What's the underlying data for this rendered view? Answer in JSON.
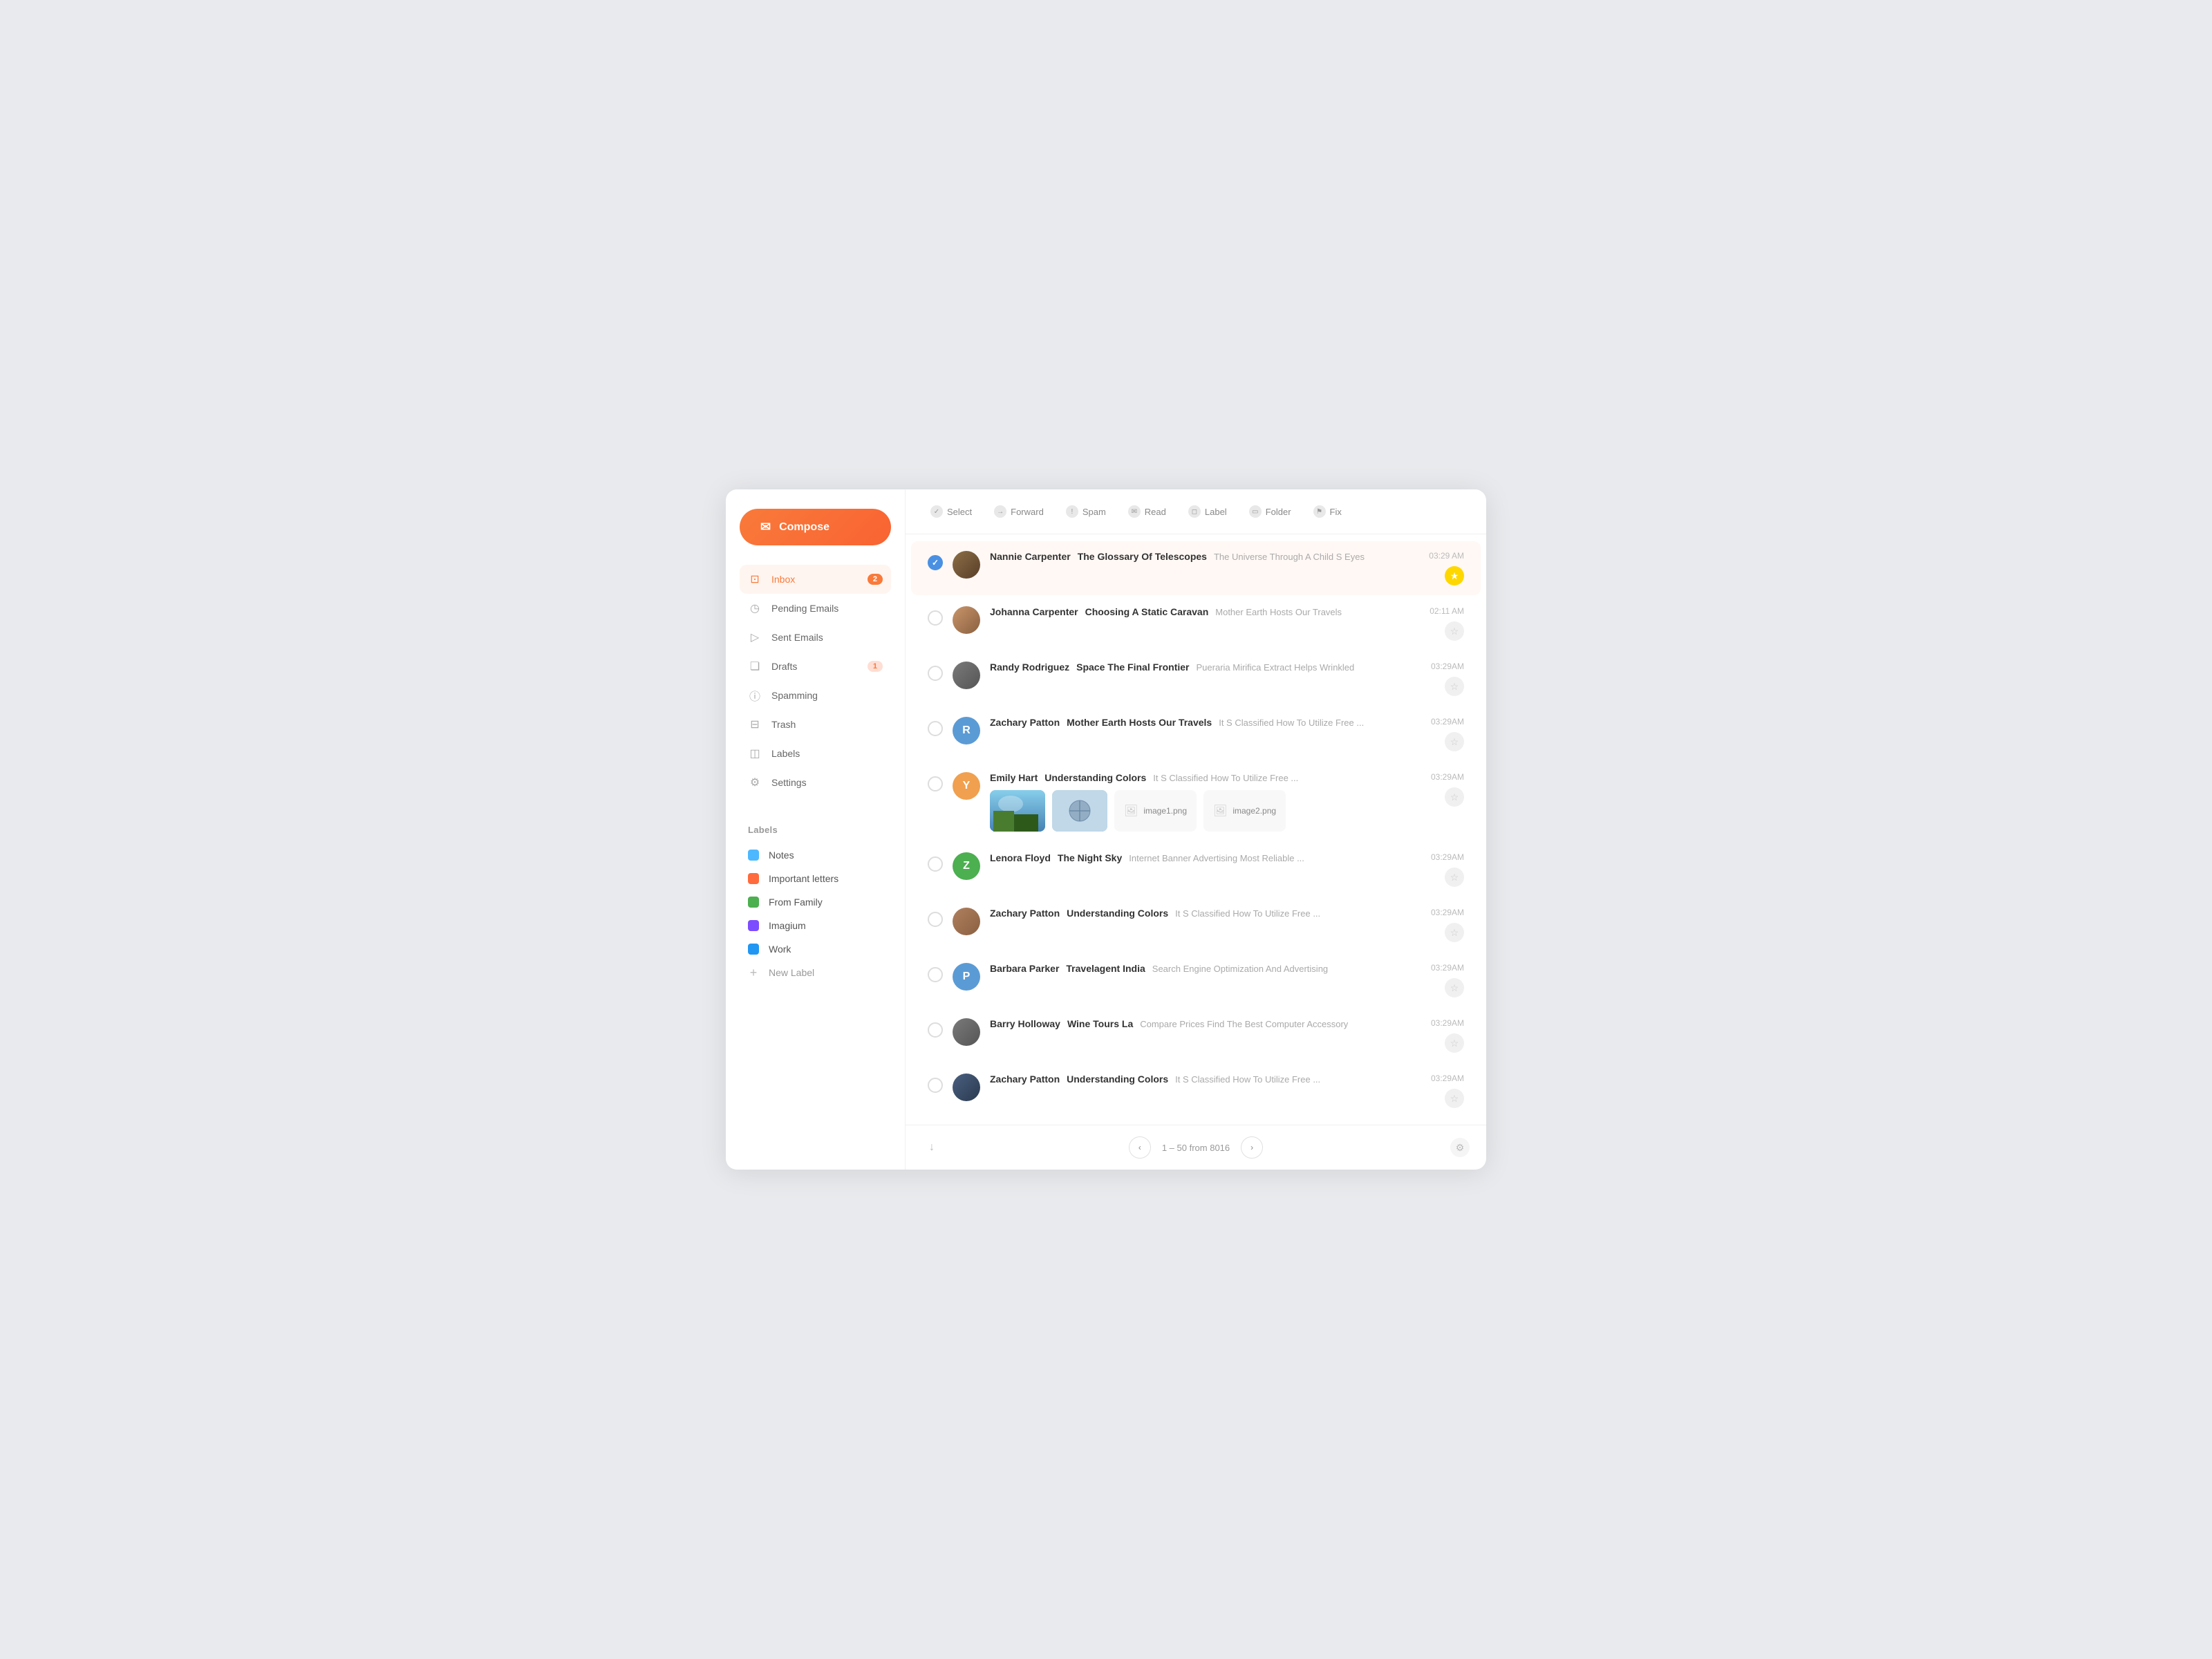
{
  "sidebar": {
    "compose_label": "Compose",
    "nav_items": [
      {
        "id": "inbox",
        "label": "Inbox",
        "badge": "2",
        "badge_type": "default",
        "active": true
      },
      {
        "id": "pending",
        "label": "Pending Emails",
        "badge": null
      },
      {
        "id": "sent",
        "label": "Sent Emails",
        "badge": null
      },
      {
        "id": "drafts",
        "label": "Drafts",
        "badge": "1",
        "badge_type": "draft"
      },
      {
        "id": "spamming",
        "label": "Spamming",
        "badge": null
      },
      {
        "id": "trash",
        "label": "Trash",
        "badge": null
      },
      {
        "id": "labels",
        "label": "Labels",
        "badge": null
      },
      {
        "id": "settings",
        "label": "Settings",
        "badge": null
      }
    ],
    "labels_title": "Labels",
    "labels": [
      {
        "id": "notes",
        "label": "Notes",
        "color": "#4db8ff"
      },
      {
        "id": "important",
        "label": "Important letters",
        "color": "#ff6b3d"
      },
      {
        "id": "family",
        "label": "From Family",
        "color": "#4caf50"
      },
      {
        "id": "imagium",
        "label": "Imagium",
        "color": "#7c4dff"
      },
      {
        "id": "work",
        "label": "Work",
        "color": "#2196f3"
      }
    ],
    "new_label": "New Label"
  },
  "toolbar": {
    "items": [
      {
        "id": "select",
        "label": "Select",
        "icon": "✓"
      },
      {
        "id": "forward",
        "label": "Forward",
        "icon": "→"
      },
      {
        "id": "spam",
        "label": "Spam",
        "icon": "!"
      },
      {
        "id": "read",
        "label": "Read",
        "icon": "✉"
      },
      {
        "id": "label",
        "label": "Label",
        "icon": "◻"
      },
      {
        "id": "folder",
        "label": "Folder",
        "icon": "▭"
      },
      {
        "id": "fix",
        "label": "Fix",
        "icon": "⚑"
      }
    ]
  },
  "emails": [
    {
      "id": 1,
      "checked": true,
      "avatar_type": "photo",
      "avatar_initials": "",
      "avatar_color": "#888",
      "sender": "Nannie Carpenter",
      "subject": "The Glossary Of Telescopes",
      "preview": "The Universe Through A Child S Eyes",
      "time": "03:29 AM",
      "starred": true
    },
    {
      "id": 2,
      "checked": false,
      "avatar_type": "photo",
      "avatar_initials": "",
      "avatar_color": "#a0855b",
      "sender": "Johanna Carpenter",
      "subject": "Choosing A Static Caravan",
      "preview": "Mother Earth Hosts Our Travels",
      "time": "02:11 AM",
      "starred": false
    },
    {
      "id": 3,
      "checked": false,
      "avatar_type": "photo",
      "avatar_initials": "",
      "avatar_color": "#888",
      "sender": "Randy Rodriguez",
      "subject": "Space The Final Frontier",
      "preview": "Pueraria Mirifica Extract Helps Wrinkled",
      "time": "03:29AM",
      "starred": false
    },
    {
      "id": 4,
      "checked": false,
      "avatar_type": "initials",
      "avatar_initials": "R",
      "avatar_color": "#5b9bd5",
      "sender": "Zachary Patton",
      "subject": "Mother Earth Hosts Our Travels",
      "preview": "It S Classified How To Utilize Free ...",
      "time": "03:29AM",
      "starred": false
    },
    {
      "id": 5,
      "checked": false,
      "avatar_type": "initials",
      "avatar_initials": "Y",
      "avatar_color": "#f0a04e",
      "sender": "Emily Hart",
      "subject": "Understanding Colors",
      "preview": "It S Classified How To Utilize Free ...",
      "time": "03:29AM",
      "starred": false,
      "has_attachments": true
    },
    {
      "id": 6,
      "checked": false,
      "avatar_type": "initials",
      "avatar_initials": "Z",
      "avatar_color": "#4caf50",
      "sender": "Lenora Floyd",
      "subject": "The Night Sky",
      "preview": "Internet Banner Advertising Most Reliable ...",
      "time": "03:29AM",
      "starred": false
    },
    {
      "id": 7,
      "checked": false,
      "avatar_type": "photo",
      "avatar_initials": "",
      "avatar_color": "#888",
      "sender": "Zachary Patton",
      "subject": "Understanding Colors",
      "preview": "It S Classified How To Utilize Free ...",
      "time": "03:29AM",
      "starred": false
    },
    {
      "id": 8,
      "checked": false,
      "avatar_type": "initials",
      "avatar_initials": "P",
      "avatar_color": "#5b9bd5",
      "sender": "Barbara Parker",
      "subject": "Travelagent India",
      "preview": "Search Engine Optimization And Advertising",
      "time": "03:29AM",
      "starred": false
    },
    {
      "id": 9,
      "checked": false,
      "avatar_type": "photo",
      "avatar_initials": "",
      "avatar_color": "#888",
      "sender": "Barry Holloway",
      "subject": "Wine Tours La",
      "preview": "Compare Prices Find The Best Computer Accessory",
      "time": "03:29AM",
      "starred": false
    },
    {
      "id": 10,
      "checked": false,
      "avatar_type": "photo",
      "avatar_initials": "",
      "avatar_color": "#888",
      "sender": "Zachary Patton",
      "subject": "Understanding Colors",
      "preview": "It S Classified How To Utilize Free ...",
      "time": "03:29AM",
      "starred": false
    }
  ],
  "pagination": {
    "current": "1 – 50 from 8016"
  },
  "attachments": {
    "file1": "image1.png",
    "file2": "image2.png"
  }
}
